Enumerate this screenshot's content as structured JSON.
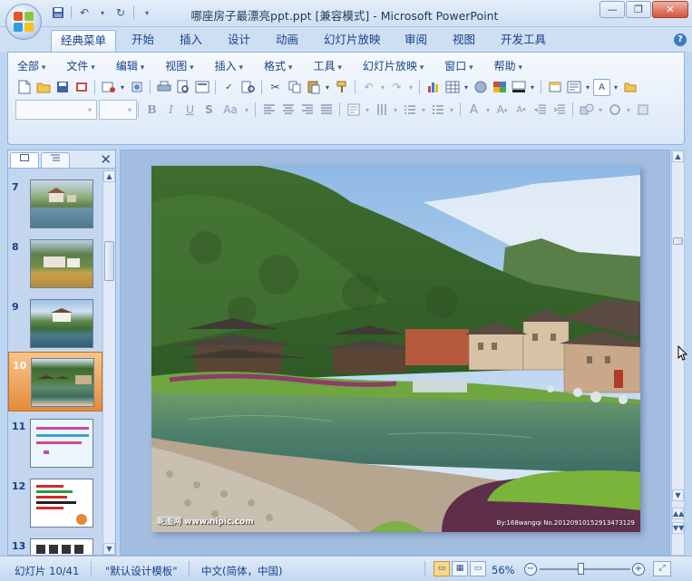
{
  "window": {
    "title": "哪座房子最漂亮ppt.ppt [兼容模式] - Microsoft PowerPoint"
  },
  "quick_access": [
    "save-icon",
    "undo-icon",
    "redo-icon",
    "customize-icon"
  ],
  "ribbon_tabs": [
    {
      "label": "经典菜单",
      "active": true
    },
    {
      "label": "开始"
    },
    {
      "label": "插入"
    },
    {
      "label": "设计"
    },
    {
      "label": "动画"
    },
    {
      "label": "幻灯片放映"
    },
    {
      "label": "审阅"
    },
    {
      "label": "视图"
    },
    {
      "label": "开发工具"
    }
  ],
  "menu": {
    "items": [
      "全部",
      "文件",
      "编辑",
      "视图",
      "插入",
      "格式",
      "工具",
      "幻灯片放映",
      "窗口",
      "帮助"
    ]
  },
  "toolbar": {
    "font_size_glyph": "Aa",
    "a_glyph": "A"
  },
  "slides_pane": {
    "items": [
      {
        "num": "7"
      },
      {
        "num": "8"
      },
      {
        "num": "9"
      },
      {
        "num": "10",
        "selected": true
      },
      {
        "num": "11"
      },
      {
        "num": "12"
      },
      {
        "num": "13"
      }
    ]
  },
  "slide": {
    "watermark_left": "昵图网 www.nipic.com",
    "watermark_right": "By:168wangqi  No.20120910152913473129"
  },
  "status": {
    "slide_info": "幻灯片 10/41",
    "template": "\"默认设计模板\"",
    "language": "中文(简体，中国)",
    "zoom": "56%",
    "zoom_fraction": 0.45
  },
  "colors": {
    "selected_thumb": "#e58b3a",
    "accent": "#15428b"
  }
}
